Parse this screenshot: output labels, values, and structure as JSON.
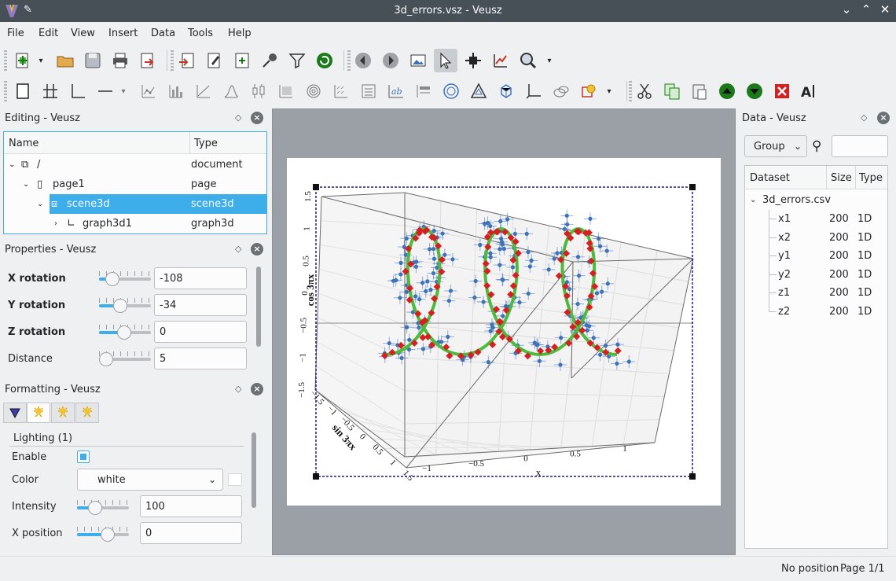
{
  "window": {
    "title": "3d_errors.vsz - Veusz"
  },
  "menu": [
    "File",
    "Edit",
    "View",
    "Insert",
    "Data",
    "Tools",
    "Help"
  ],
  "editing": {
    "title": "Editing - Veusz",
    "columns": [
      "Name",
      "Type"
    ],
    "rows": [
      {
        "name": "/",
        "type": "document"
      },
      {
        "name": "page1",
        "type": "page"
      },
      {
        "name": "scene3d",
        "type": "scene3d"
      },
      {
        "name": "graph3d1",
        "type": "graph3d"
      }
    ]
  },
  "properties": {
    "title": "Properties - Veusz",
    "rows": [
      {
        "label": "X rotation",
        "value": "-108"
      },
      {
        "label": "Y rotation",
        "value": "-34"
      },
      {
        "label": "Z rotation",
        "value": "0"
      },
      {
        "label": "Distance",
        "value": "5"
      }
    ]
  },
  "formatting": {
    "title": "Formatting - Veusz",
    "group": "Lighting (1)",
    "enable_label": "Enable",
    "color_label": "Color",
    "color_value": "white",
    "intensity_label": "Intensity",
    "intensity_value": "100",
    "xpos_label": "X position",
    "xpos_value": "0"
  },
  "data": {
    "title": "Data - Veusz",
    "group_button": "Group",
    "columns": [
      "Dataset",
      "Size",
      "Type"
    ],
    "file": "3d_errors.csv",
    "datasets": [
      {
        "name": "x1",
        "size": "200",
        "type": "1D"
      },
      {
        "name": "x2",
        "size": "200",
        "type": "1D"
      },
      {
        "name": "y1",
        "size": "200",
        "type": "1D"
      },
      {
        "name": "y2",
        "size": "200",
        "type": "1D"
      },
      {
        "name": "z1",
        "size": "200",
        "type": "1D"
      },
      {
        "name": "z2",
        "size": "200",
        "type": "1D"
      }
    ]
  },
  "plot": {
    "xlabel": "x",
    "ylabel": "sin 3πx",
    "zlabel": "cos 3πx",
    "xticks": [
      "−1",
      "−0.5",
      "0",
      "0.5",
      "1"
    ],
    "yticks": [
      "−1.5",
      "−1",
      "−0.5",
      "0",
      "0.5",
      "1",
      "1.5"
    ],
    "zticks": [
      "−1.5",
      "−1",
      "−0.5",
      "0",
      "0.5",
      "1",
      "1.5"
    ],
    "colors": {
      "line": "#4cbb3c",
      "error_points": "#d42020",
      "scatter_points": "#3d72b8"
    }
  },
  "status": {
    "position": "No position",
    "page": "Page 1/1"
  }
}
